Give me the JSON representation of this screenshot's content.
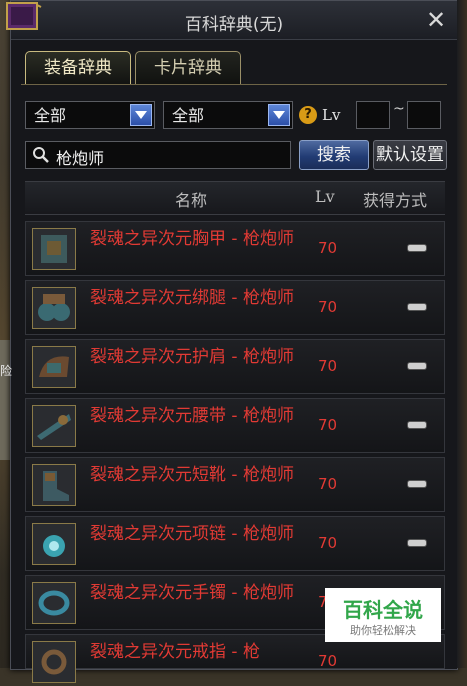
{
  "window": {
    "title": "百科辞典(无)"
  },
  "tabs": [
    {
      "label": "装备辞典",
      "active": true
    },
    {
      "label": "卡片辞典",
      "active": false
    }
  ],
  "filters": {
    "select1": "全部",
    "select2": "全部",
    "lv_label": "Lv",
    "tilde": "~",
    "lv_min": "",
    "lv_max": ""
  },
  "search": {
    "value": "枪炮师",
    "search_button": "搜索",
    "default_button": "默认设置"
  },
  "columns": {
    "name": "名称",
    "lv": "Lv",
    "acquire": "获得方式"
  },
  "items": [
    {
      "name": "裂魂之异次元胸甲 - 枪炮师",
      "lv": "70"
    },
    {
      "name": "裂魂之异次元绑腿 - 枪炮师",
      "lv": "70"
    },
    {
      "name": "裂魂之异次元护肩 - 枪炮师",
      "lv": "70"
    },
    {
      "name": "裂魂之异次元腰带 - 枪炮师",
      "lv": "70"
    },
    {
      "name": "裂魂之异次元短靴 - 枪炮师",
      "lv": "70"
    },
    {
      "name": "裂魂之异次元项链 - 枪炮师",
      "lv": "70"
    },
    {
      "name": "裂魂之异次元手镯 - 枪炮师",
      "lv": "70"
    },
    {
      "name": "裂魂之异次元戒指 - 枪",
      "lv": "70"
    }
  ],
  "watermark": {
    "title": "百科全说",
    "subtitle": "助你轻松解决"
  },
  "colors": {
    "item_name": "#e23a34",
    "accent_blue": "#2c4fa8",
    "watermark_green": "#31a64a"
  }
}
